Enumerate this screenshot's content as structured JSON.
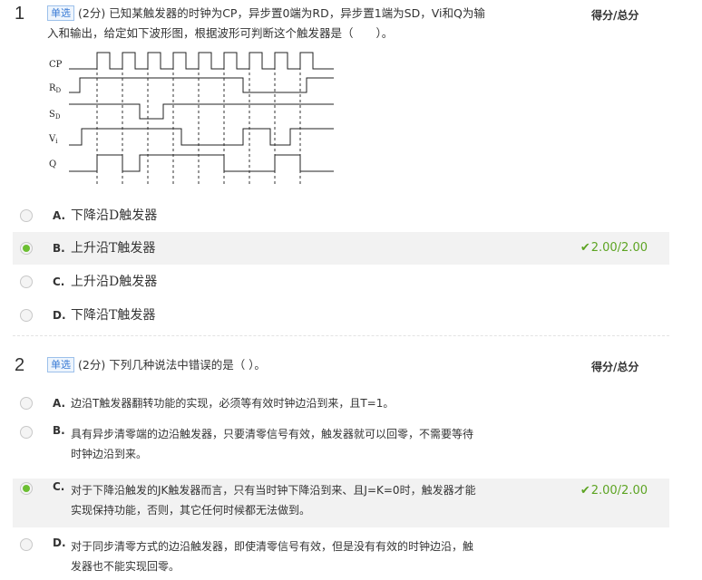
{
  "q1": {
    "number": "1",
    "type_tag": "单选",
    "points": "(2分)",
    "text_line1": "已知某触发器的时钟为CP，异步置0端为RD，异步置1端为SD，Vi和Q为输",
    "text_line2": "入和输出，给定如下波形图，根据波形可判断这个触发器是（　　）。",
    "score_header": "得分/总分",
    "waveform": {
      "signals": [
        {
          "label": "CP",
          "sub": ""
        },
        {
          "label": "R",
          "sub": "D"
        },
        {
          "label": "S",
          "sub": "D"
        },
        {
          "label": "V",
          "sub": "i"
        },
        {
          "label": "Q",
          "sub": ""
        }
      ]
    },
    "options": [
      {
        "letter": "A.",
        "text": "下降沿D触发器",
        "selected": false
      },
      {
        "letter": "B.",
        "text": "上升沿T触发器",
        "selected": true
      },
      {
        "letter": "C.",
        "text": "上升沿D触发器",
        "selected": false
      },
      {
        "letter": "D.",
        "text": "下降沿T触发器",
        "selected": false
      }
    ],
    "score": "2.00/2.00"
  },
  "q2": {
    "number": "2",
    "type_tag": "单选",
    "points": "(2分)",
    "text": "下列几种说法中错误的是（ ）。",
    "score_header": "得分/总分",
    "options": [
      {
        "letter": "A.",
        "line1": "边沿T触发器翻转功能的实现，必须等有效时钟边沿到来，且T=1。",
        "line2": "",
        "selected": false
      },
      {
        "letter": "B.",
        "line1": "具有异步清零端的边沿触发器，只要清零信号有效，触发器就可以回零，不需要等待",
        "line2": "时钟边沿到来。",
        "selected": false
      },
      {
        "letter": "C.",
        "line1": "对于下降沿触发的JK触发器而言，只有当时钟下降沿到来、且J=K=0时，触发器才能",
        "line2": "实现保持功能，否则，其它任何时候都无法做到。",
        "selected": true
      },
      {
        "letter": "D.",
        "line1": "对于同步清零方式的边沿触发器，即使清零信号有效，但是没有有效的时钟边沿，触",
        "line2": "发器也不能实现回零。",
        "selected": false
      }
    ],
    "score": "2.00/2.00"
  },
  "colors": {
    "accent_green": "#5da423",
    "radio_selected": "#6cbf32",
    "tag_blue": "#3a7bd5"
  }
}
